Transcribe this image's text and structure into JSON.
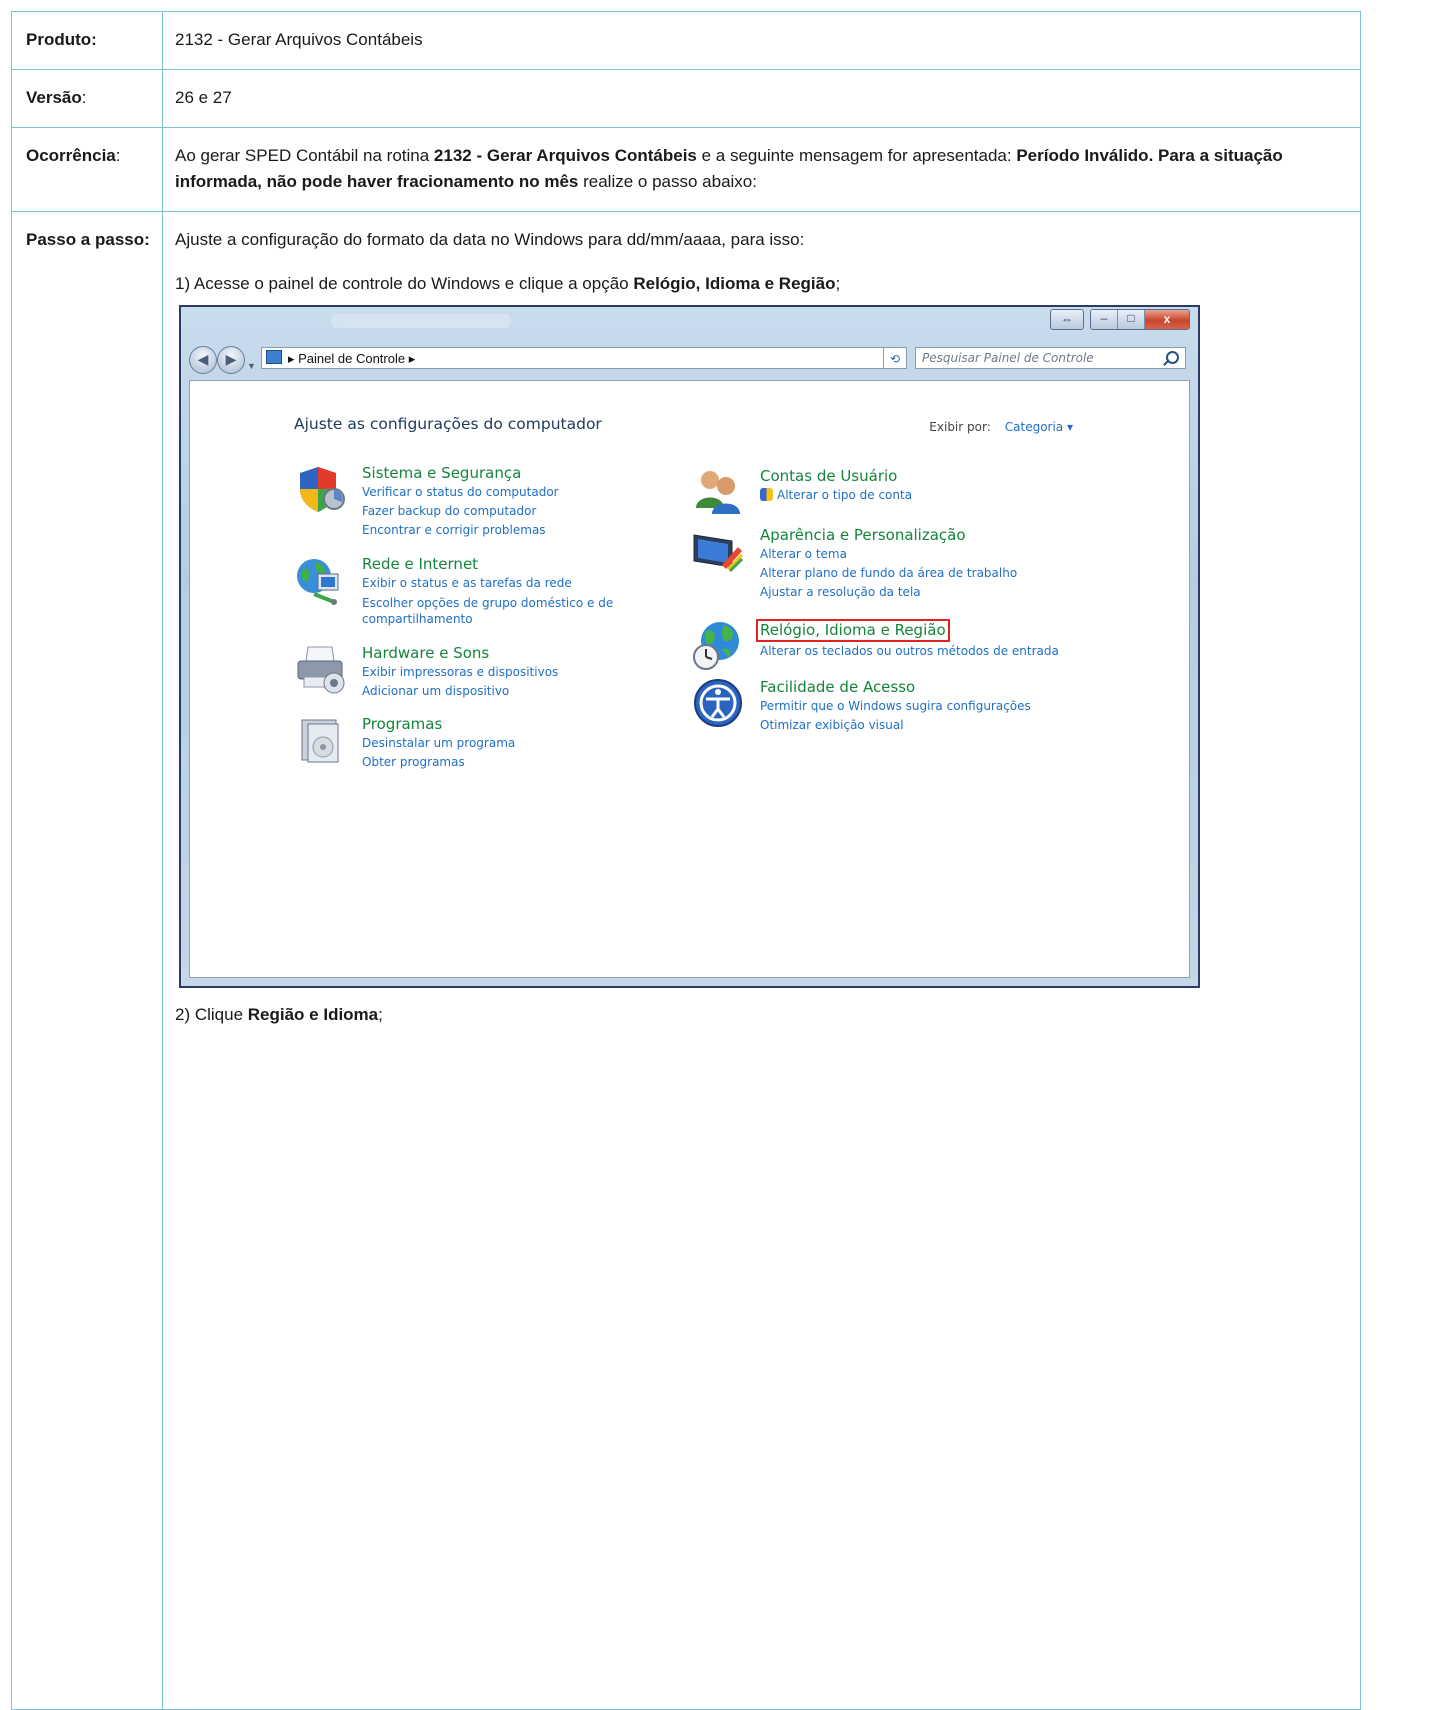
{
  "doc": {
    "rows": {
      "produto": {
        "label": "Produto:",
        "value": "2132 - Gerar Arquivos Contábeis"
      },
      "versao": {
        "label": "Versão",
        "colon": ":",
        "value": "26 e 27"
      },
      "ocorrencia": {
        "label": "Ocorrência",
        "colon": ":",
        "text_1": "Ao gerar SPED Contábil na rotina ",
        "bold_1": "2132 - Gerar Arquivos Contábeis",
        "text_2": "  e a seguinte mensagem for apresentada: ",
        "bold_2": "Período Inválido. Para a situação informada, não pode haver fracionamento no mês",
        "text_3": "  realize o passo abaixo:"
      },
      "passo": {
        "label": "Passo a passo:",
        "intro": "Ajuste a configuração do formato da data no Windows para dd/mm/aaaa, para isso:",
        "step1_pre": "1) Acesse o painel de controle do Windows e clique a opção ",
        "step1_bold": "Relógio, Idioma e Região",
        "step1_post": ";",
        "step2_pre": "2) Clique ",
        "step2_bold": "Região e Idioma",
        "step2_post": ";"
      }
    }
  },
  "window": {
    "caption_buttons": {
      "swap": "⇔",
      "minimize": "–",
      "maximize": "□",
      "close": "x"
    },
    "address": {
      "path": "▸ Painel de Controle ▸",
      "dropdown": "▾"
    },
    "refresh": "⟲",
    "search": {
      "placeholder": "Pesquisar Painel de Controle"
    },
    "heading": "Ajuste as configurações do computador",
    "view_by": {
      "label": "Exibir por:",
      "value": "Categoria ▾"
    },
    "categories_left": [
      {
        "title": "Sistema e Segurança",
        "icon": "shield-icon",
        "links": [
          "Verificar o status do computador",
          "Fazer backup do computador",
          "Encontrar e corrigir problemas"
        ]
      },
      {
        "title": "Rede e Internet",
        "icon": "network-globe-icon",
        "links": [
          "Exibir o status e as tarefas da rede",
          "Escolher opções de grupo doméstico e de compartilhamento"
        ]
      },
      {
        "title": "Hardware e Sons",
        "icon": "printer-icon",
        "links": [
          "Exibir impressoras e dispositivos",
          "Adicionar um dispositivo"
        ]
      },
      {
        "title": "Programas",
        "icon": "programs-icon",
        "links": [
          "Desinstalar um programa",
          "Obter programas"
        ]
      }
    ],
    "categories_right": [
      {
        "title": "Contas de Usuário",
        "icon": "users-icon",
        "links": [
          "Alterar o tipo de conta"
        ]
      },
      {
        "title": "Aparência e Personalização",
        "icon": "monitor-paint-icon",
        "links": [
          "Alterar o tema",
          "Alterar plano de fundo da área de trabalho",
          "Ajustar a resolução da tela"
        ]
      },
      {
        "title": "Relógio, Idioma e Região",
        "icon": "globe-clock-icon",
        "links": [
          "Alterar os teclados ou outros métodos de entrada"
        ]
      },
      {
        "title": "Facilidade de Acesso",
        "icon": "ease-of-access-icon",
        "links": [
          "Permitir que o Windows sugira configurações",
          "Otimizar exibição visual"
        ]
      }
    ],
    "colors": {
      "link": "#1f6fc5",
      "category_title": "#14853a",
      "highlight": "#e02424"
    }
  }
}
